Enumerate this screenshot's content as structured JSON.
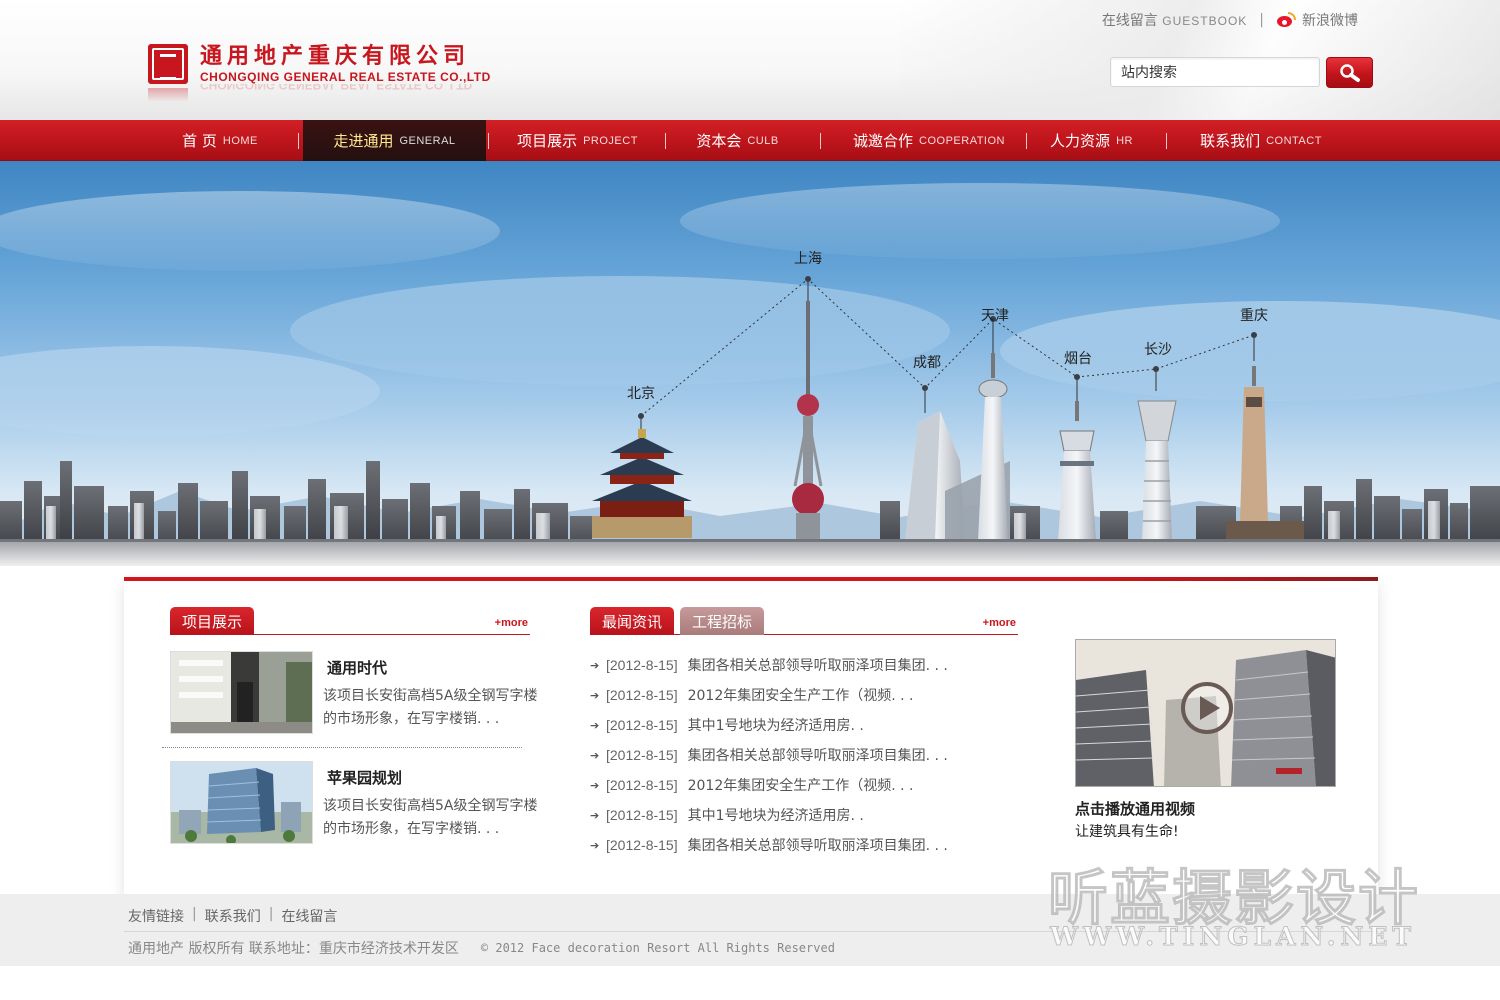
{
  "header": {
    "logo_cn": "通用地产重庆有限公司",
    "logo_en": "CHONGQING GENERAL REAL ESTATE CO.,LTD",
    "guestbook_cn": "在线留言",
    "guestbook_en": "GUESTBOOK",
    "weibo": "新浪微博",
    "weibo_icon": "weibo-icon",
    "search_value": "站内搜索",
    "search_button_icon": "magnifier-icon"
  },
  "nav": {
    "items": [
      {
        "label": "首 页",
        "en": "HOME"
      },
      {
        "label": "走进通用",
        "en": "GENERAL",
        "active": true
      },
      {
        "label": "项目展示",
        "en": "PROJECT"
      },
      {
        "label": "资本会",
        "en": "CULB"
      },
      {
        "label": "诚邀合作",
        "en": "COOPERATION"
      },
      {
        "label": "人力资源",
        "en": "HR"
      },
      {
        "label": "联系我们",
        "en": "CONTACT"
      }
    ]
  },
  "banner": {
    "cities": [
      "北京",
      "上海",
      "成都",
      "天津",
      "烟台",
      "长沙",
      "重庆"
    ]
  },
  "projects": {
    "tab": "项目展示",
    "more": "+more",
    "items": [
      {
        "name": "通用时代",
        "desc": "该项目长安街高档5A级全钢写字楼的市场形象，在写字楼销. . ."
      },
      {
        "name": "苹果园规划",
        "desc": "该项目长安街高档5A级全钢写字楼的市场形象，在写字楼销. . ."
      }
    ]
  },
  "news": {
    "tab_active": "最闻资讯",
    "tab_inactive": "工程招标",
    "more": "+more",
    "items": [
      {
        "date": "[2012-8-15]",
        "title": "集团各相关总部领导听取丽泽项目集团. . ."
      },
      {
        "date": "[2012-8-15]",
        "title": "2012年集团安全生产工作（视频. . ."
      },
      {
        "date": "[2012-8-15]",
        "title": "其中1号地块为经济适用房. ."
      },
      {
        "date": "[2012-8-15]",
        "title": "集团各相关总部领导听取丽泽项目集团. . ."
      },
      {
        "date": "[2012-8-15]",
        "title": "2012年集团安全生产工作（视频. . ."
      },
      {
        "date": "[2012-8-15]",
        "title": "其中1号地块为经济适用房. ."
      },
      {
        "date": "[2012-8-15]",
        "title": "集团各相关总部领导听取丽泽项目集团. . ."
      }
    ]
  },
  "video": {
    "title": "点击播放通用视频",
    "subtitle": "让建筑具有生命!",
    "play_icon": "play-icon"
  },
  "footer": {
    "links": [
      "友情链接",
      "联系我们",
      "在线留言"
    ],
    "company": "通用地产 版权所有 联系地址：重庆市经济技术开发区",
    "copyright": "© 2012 Face decoration Resort All Rights Reserved"
  },
  "watermark": {
    "cn": "听蓝摄影设计",
    "en": "WWW.TINGLAN.NET"
  },
  "colors": {
    "brand_red": "#c8161e",
    "nav_active": "#241010",
    "sky": "#6aa7d9"
  }
}
